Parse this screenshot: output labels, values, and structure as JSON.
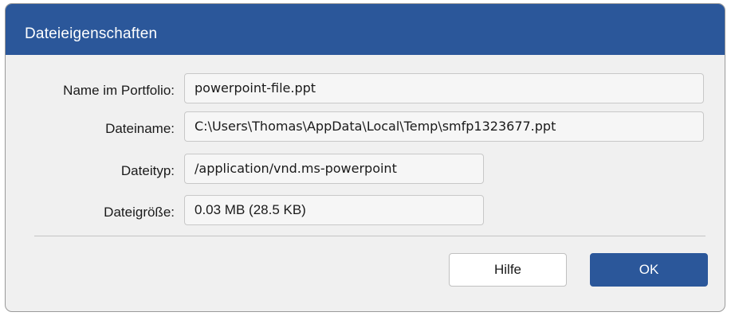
{
  "dialog": {
    "title": "Dateieigenschaften"
  },
  "fields": {
    "name_label": "Name im Portfolio:",
    "name_value": "powerpoint-file.ppt",
    "filename_label": "Dateiname:",
    "filename_value": "C:\\Users\\Thomas\\AppData\\Local\\Temp\\smfp1323677.ppt",
    "type_label": "Dateityp:",
    "type_value": "/application/vnd.ms-powerpoint",
    "size_label": "Dateigröße:",
    "size_value": "0.03 MB (28.5 KB)"
  },
  "buttons": {
    "help_label": "Hilfe",
    "ok_label": "OK"
  },
  "colors": {
    "accent": "#2b579a",
    "background": "#f0f0f0"
  }
}
